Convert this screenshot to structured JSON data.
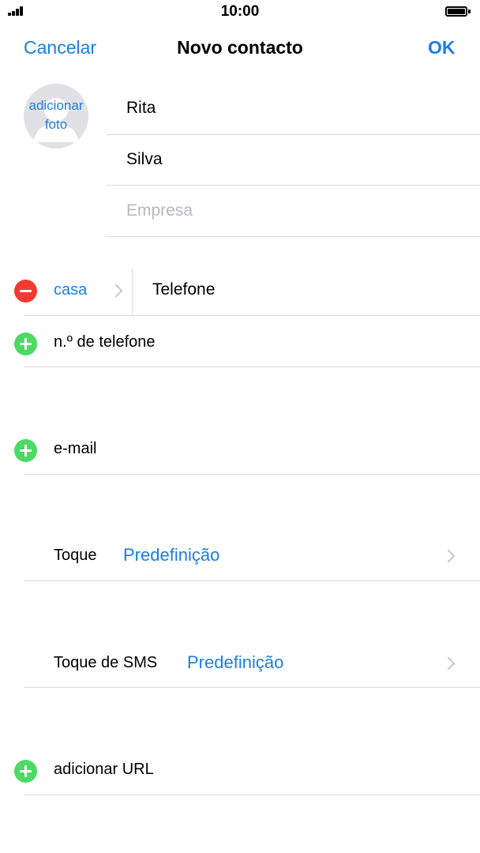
{
  "status_bar": {
    "time": "10:00"
  },
  "nav": {
    "cancel_label": "Cancelar",
    "title": "Novo contacto",
    "ok_label": "OK"
  },
  "avatar": {
    "label_line1": "adicionar",
    "label_line2": "foto"
  },
  "name_fields": {
    "first_name": "Rita",
    "last_name": "Silva",
    "company_placeholder": "Empresa"
  },
  "phone": {
    "label": "casa",
    "placeholder": "Telefone",
    "add_label": "n.º de telefone"
  },
  "email": {
    "add_label": "e-mail"
  },
  "ringtone": {
    "label": "Toque",
    "value": "Predefinição"
  },
  "text_tone": {
    "label": "Toque de SMS",
    "value": "Predefinição"
  },
  "url": {
    "add_label": "adicionar URL"
  },
  "colors": {
    "accent": "#1a7fe3",
    "remove": "#f23b30",
    "add": "#4cd964",
    "placeholder": "#b8b8bd",
    "divider": "#d8d8dc"
  }
}
